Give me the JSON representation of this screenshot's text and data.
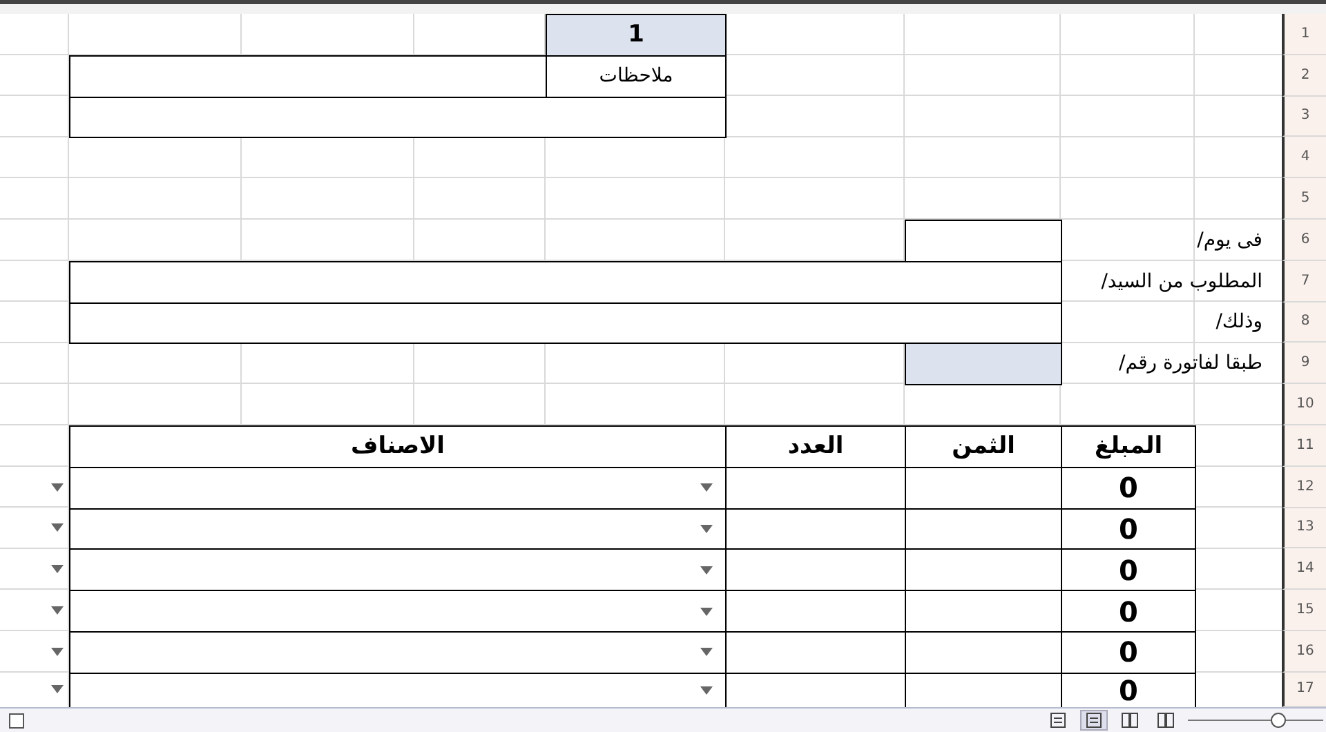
{
  "sheet": {
    "serial": "1",
    "notes_label": "ملاحظات"
  },
  "fields": [
    {
      "label": "فى يوم/",
      "kind": "short"
    },
    {
      "label": "المطلوب من السيد/",
      "kind": "wide"
    },
    {
      "label": "وذلك/",
      "kind": "wide"
    },
    {
      "label": "طبقا لفاتورة رقم/",
      "kind": "shaded"
    }
  ],
  "table": {
    "columns": [
      "المبلغ",
      "الثمن",
      "العدد",
      "الاصناف"
    ],
    "rows": [
      {
        "amount": "0"
      },
      {
        "amount": "0"
      },
      {
        "amount": "0"
      },
      {
        "amount": "0"
      },
      {
        "amount": "0"
      },
      {
        "amount": "0"
      }
    ]
  },
  "row_numbers": [
    "1",
    "2",
    "3",
    "4",
    "5",
    "6",
    "7",
    "8",
    "9",
    "10",
    "11",
    "12",
    "13",
    "14",
    "15",
    "16",
    "17"
  ],
  "status_bar": {
    "views": [
      {
        "selected": false
      },
      {
        "selected": true
      },
      {
        "selected": false
      },
      {
        "selected": false
      }
    ],
    "zoom": {
      "level": 0.67
    }
  }
}
